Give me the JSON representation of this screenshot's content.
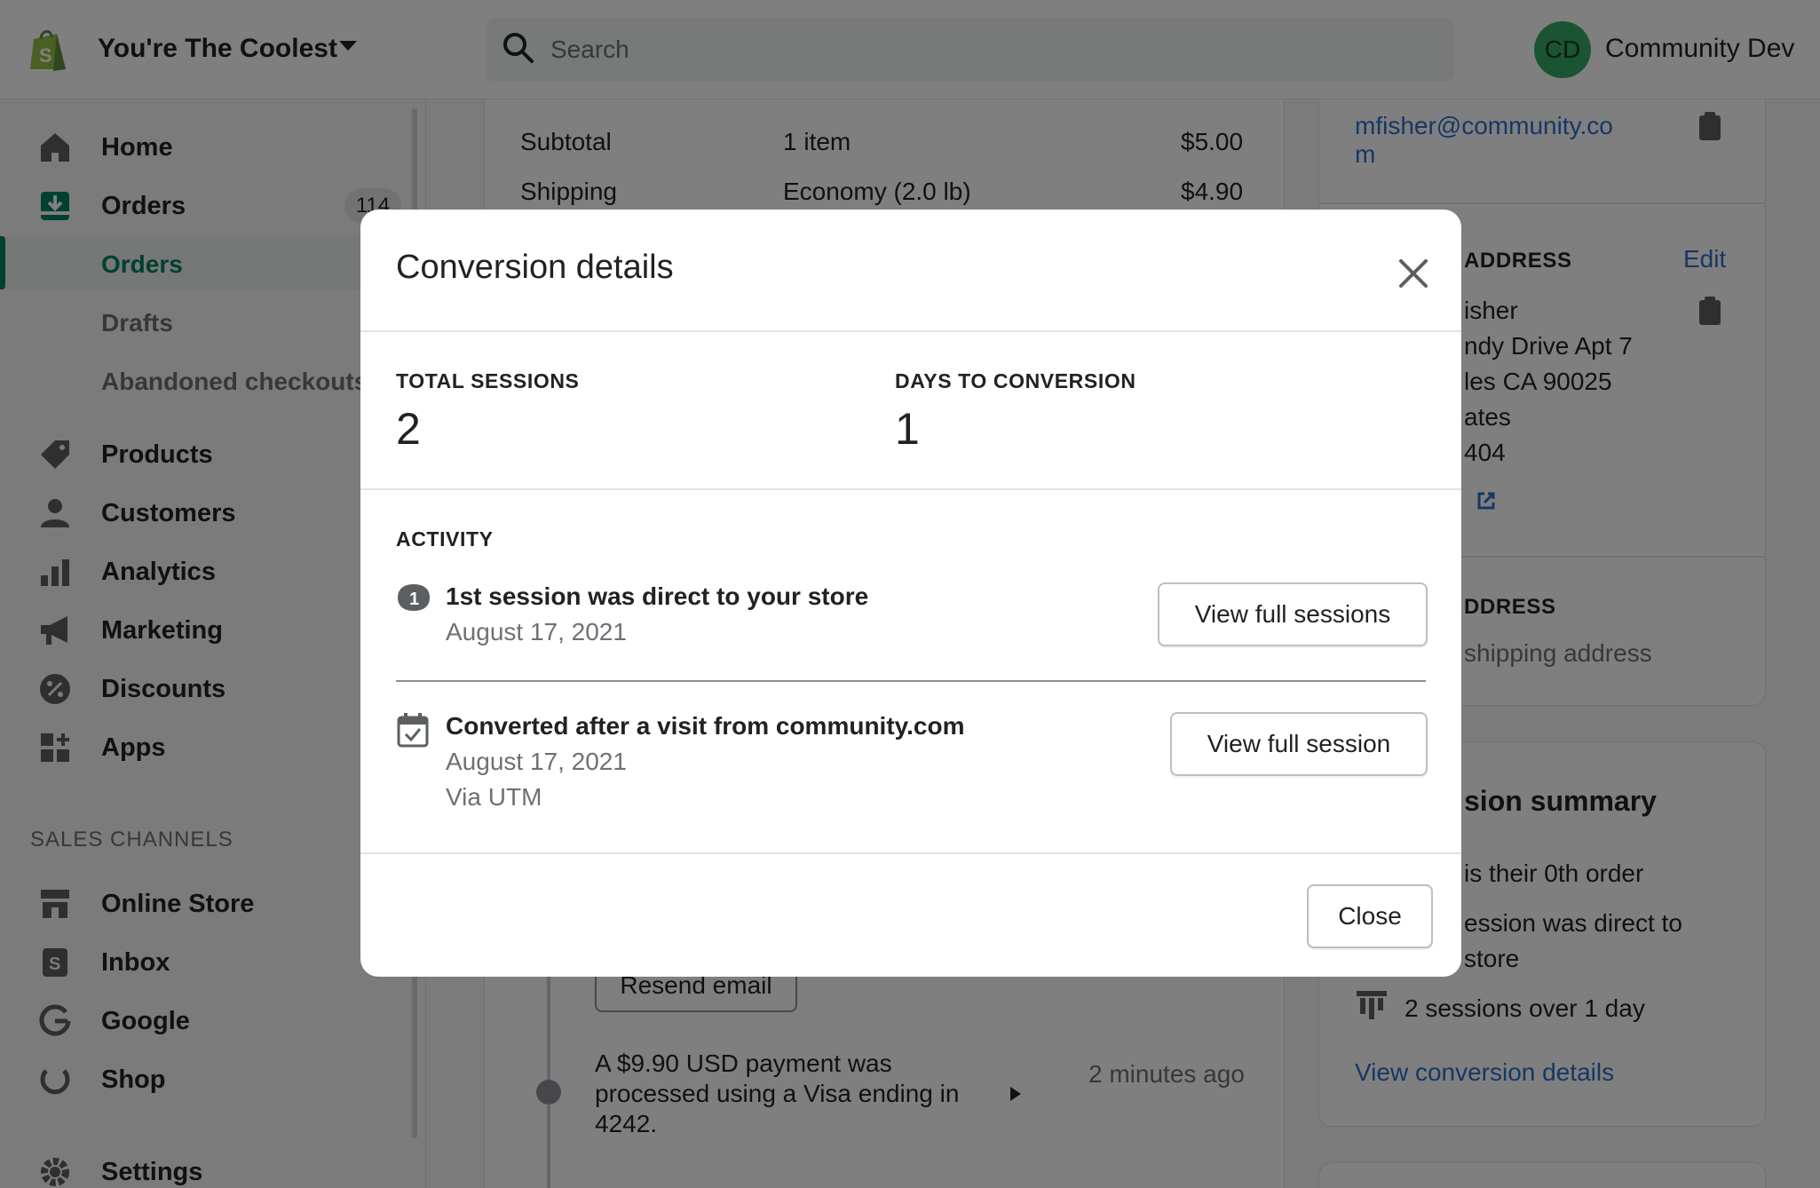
{
  "topbar": {
    "store_name": "You're The Coolest",
    "search_placeholder": "Search",
    "avatar_initials": "CD",
    "user_name": "Community Dev"
  },
  "sidebar": {
    "items": [
      {
        "label": "Home",
        "icon": "home-icon"
      },
      {
        "label": "Orders",
        "icon": "orders-icon",
        "badge": "114"
      },
      {
        "label": "Orders",
        "sub": true,
        "selected": true
      },
      {
        "label": "Drafts",
        "sub": true
      },
      {
        "label": "Abandoned checkouts",
        "sub": true
      },
      {
        "label": "Products",
        "icon": "tag-icon"
      },
      {
        "label": "Customers",
        "icon": "person-icon"
      },
      {
        "label": "Analytics",
        "icon": "bar-chart-icon"
      },
      {
        "label": "Marketing",
        "icon": "megaphone-icon"
      },
      {
        "label": "Discounts",
        "icon": "discount-icon"
      },
      {
        "label": "Apps",
        "icon": "apps-icon"
      }
    ],
    "sales_channels_heading": "SALES CHANNELS",
    "channels": [
      {
        "label": "Online Store",
        "icon": "store-icon"
      },
      {
        "label": "Inbox",
        "icon": "inbox-icon"
      },
      {
        "label": "Google",
        "icon": "google-icon"
      },
      {
        "label": "Shop",
        "icon": "shop-icon"
      }
    ],
    "settings_label": "Settings"
  },
  "order": {
    "subtotal_label": "Subtotal",
    "subtotal_qty": "1 item",
    "subtotal_amount": "$5.00",
    "shipping_label": "Shipping",
    "shipping_method": "Economy (2.0 lb)",
    "shipping_amount": "$4.90",
    "resend_email": "Resend email",
    "payment_text_1": "A $9.90 USD payment was",
    "payment_text_2": "processed using a Visa ending in",
    "payment_text_3": "4242.",
    "payment_time": "2 minutes ago"
  },
  "right_panel": {
    "email_1": "mfisher@community.co",
    "email_2": "m",
    "shipping_heading": "ADDRESS",
    "edit": "Edit",
    "addr_1": "isher",
    "addr_2": "ndy Drive Apt 7",
    "addr_3": "les CA 90025",
    "addr_4": "ates",
    "addr_5": "404",
    "billing_heading": "DDRESS",
    "billing_same": "shipping address",
    "summary_title": "sion summary",
    "summary_1": "is their 0th order",
    "summary_2a": "ession was direct to",
    "summary_2b": "store",
    "summary_3": "2 sessions over 1 day",
    "view_conversion": "View conversion details"
  },
  "modal": {
    "title": "Conversion details",
    "total_sessions_label": "TOTAL SESSIONS",
    "total_sessions_value": "2",
    "days_label": "DAYS TO CONVERSION",
    "days_value": "1",
    "activity_heading": "ACTIVITY",
    "activity": [
      {
        "title": "1st session was direct to your store",
        "date": "August 17, 2021",
        "button": "View full sessions"
      },
      {
        "title": "Converted after a visit from community.com",
        "date": "August 17, 2021",
        "via": "Via UTM",
        "button": "View full session"
      }
    ],
    "close_button": "Close"
  },
  "colors": {
    "brand_green": "#008060",
    "link_blue": "#2c6ecb",
    "overlay": "#000000"
  }
}
